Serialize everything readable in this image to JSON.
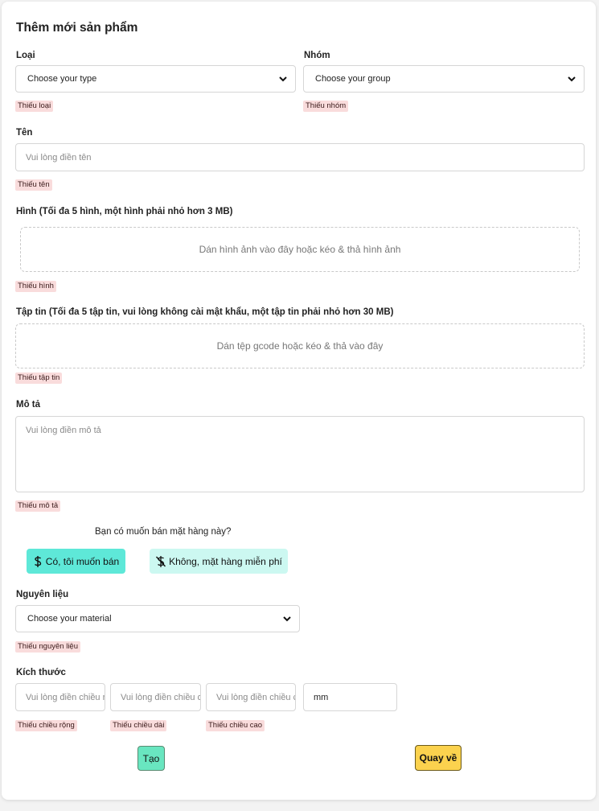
{
  "form": {
    "title": "Thêm mới sản phẩm",
    "type": {
      "label": "Loại",
      "selected": "Choose your type",
      "error": "Thiếu loại"
    },
    "group": {
      "label": "Nhóm",
      "selected": "Choose your group",
      "error": "Thiếu nhóm"
    },
    "name": {
      "label": "Tên",
      "placeholder": "Vui lòng điền tên",
      "error": "Thiếu tên"
    },
    "images": {
      "label": "Hình (Tối đa 5 hình, một hình phải nhỏ hơn 3 MB)",
      "drop_text": "Dán hình ảnh vào đây hoặc kéo & thả hình ảnh",
      "error": "Thiếu hình"
    },
    "files": {
      "label": "Tập tin (Tối đa 5 tập tin, vui lòng không cài mật khẩu, một tập tin phải nhỏ hơn 30 MB)",
      "drop_text": "Dán tệp gcode hoặc kéo & thả vào đây",
      "error": "Thiếu tập tin"
    },
    "description": {
      "label": "Mô tả",
      "placeholder": "Vui lòng điền mô tả",
      "error": "Thiếu mô tả"
    },
    "sell": {
      "question": "Bạn có muốn bán mặt hàng này?",
      "yes_label": "Có, tôi muốn bán",
      "no_label": "Không, mặt hàng miễn phí"
    },
    "material": {
      "label": "Nguyên liệu",
      "selected": "Choose your material",
      "error": "Thiếu nguyên liệu"
    },
    "size": {
      "label": "Kích thước",
      "width_placeholder": "Vui lòng điền chiều rộng",
      "length_placeholder": "Vui lòng điền chiều dài",
      "height_placeholder": "Vui lòng điền chiều cao",
      "unit": "mm",
      "width_error": "Thiếu chiều rộng",
      "length_error": "Thiếu chiều dài",
      "height_error": "Thiếu chiều cao"
    },
    "buttons": {
      "create": "Tạo",
      "back": "Quay về"
    }
  },
  "colors": {
    "teal": "#5ee8d8",
    "teal_light": "#ccf8f1",
    "green": "#69e6c0",
    "yellow": "#fbd24e",
    "error_bg": "#f9dcdc"
  },
  "icons": {
    "dollar": "dollar-icon",
    "no_dollar": "dollar-off-icon",
    "chevron": "chevron-down-icon"
  }
}
